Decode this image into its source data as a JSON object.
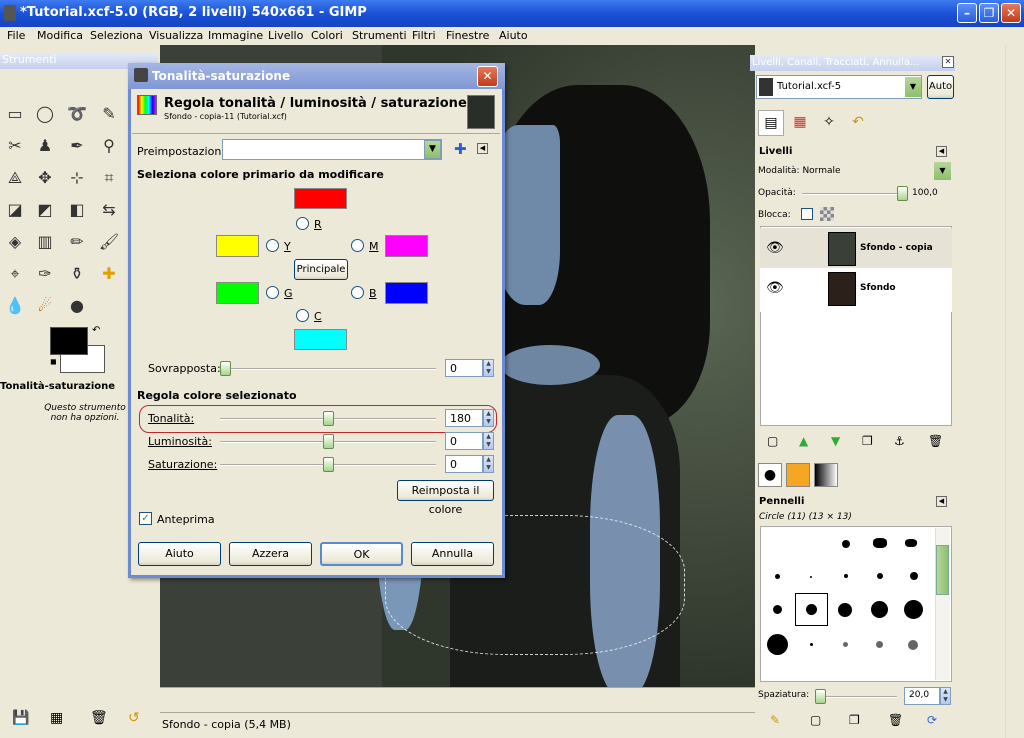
{
  "window": {
    "title": "*Tutorial.xcf-5.0 (RGB, 2 livelli) 540x661 - GIMP"
  },
  "menu": [
    "File",
    "Modifica",
    "Seleziona",
    "Visualizza",
    "Immagine",
    "Livello",
    "Colori",
    "Strumenti",
    "Filtri",
    "Finestre",
    "Aiuto"
  ],
  "toolbox": {
    "title": "Strumenti",
    "tool_options_title": "Tonalità-saturazione",
    "tool_options_text": "Questo strumento non ha opzioni."
  },
  "dialog": {
    "title": "Tonalità-saturazione",
    "heading": "Regola tonalità / luminosità / saturazione",
    "subheading": "Sfondo - copia-11 (Tutorial.xcf)",
    "presets_label": "Preimpostazioni:",
    "section1": "Seleziona colore primario da modificare",
    "colors": {
      "R": "R",
      "Y": "Y",
      "M": "M",
      "G": "G",
      "B": "B",
      "C": "C",
      "master": "Principale"
    },
    "overlap_label": "Sovrapposta:",
    "overlap_value": "0",
    "section2": "Regola colore selezionato",
    "hue_label": "Tonalità:",
    "hue_value": "180",
    "lightness_label": "Luminosità:",
    "lightness_value": "0",
    "saturation_label": "Saturazione:",
    "saturation_value": "0",
    "reset_color": "Reimposta il colore",
    "preview_label": "Anteprima",
    "buttons": {
      "help": "Aiuto",
      "reset": "Azzera",
      "ok": "OK",
      "cancel": "Annulla"
    }
  },
  "status": {
    "text": "Sfondo - copia (5,4 MB)"
  },
  "layers_dock": {
    "title": "Livelli, Canali, Tracciati, Annulla...",
    "image_select": "Tutorial.xcf-5",
    "auto": "Auto",
    "section": "Livelli",
    "mode": "Modalità: Normale",
    "opacity_label": "Opacità:",
    "opacity_value": "100,0",
    "lock_label": "Blocca:",
    "layers": [
      {
        "name": "Sfondo - copia"
      },
      {
        "name": "Sfondo"
      }
    ]
  },
  "brushes_dock": {
    "section": "Pennelli",
    "brush_name": "Circle (11) (13 × 13)",
    "spacing_label": "Spaziatura:",
    "spacing_value": "20,0"
  }
}
